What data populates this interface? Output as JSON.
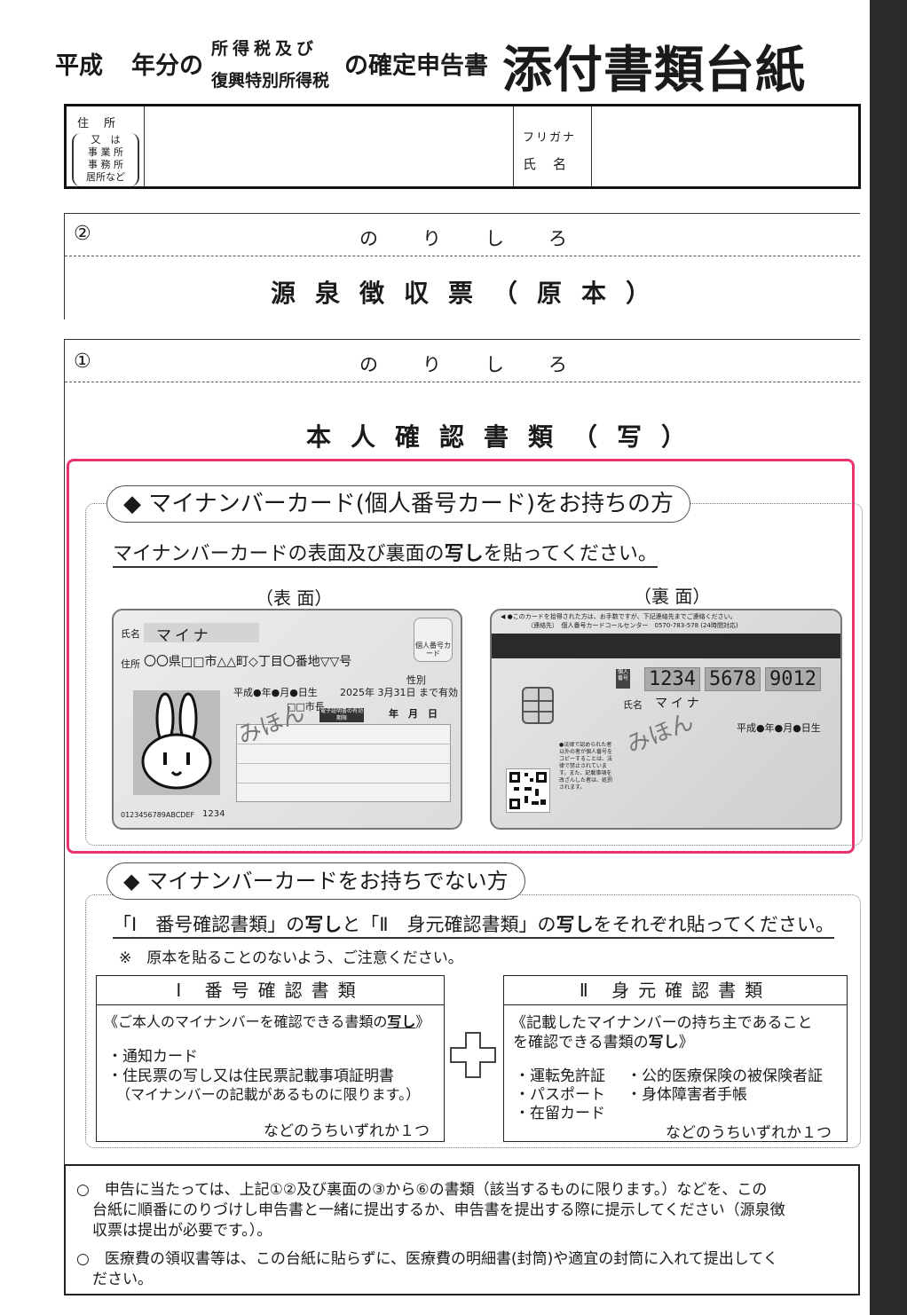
{
  "title": {
    "era": "平成",
    "year_suffix": "年分の",
    "tax_line1": "所得税及び",
    "tax_line2": "復興特別所得税",
    "doc_suffix": "の確定申告書",
    "main": "添付書類台紙"
  },
  "address_table": {
    "address_label": "住　所",
    "alt_labels": [
      "又　は",
      "事 業 所",
      "事 務 所",
      "居所など"
    ],
    "furigana_label": "フリガナ",
    "name_label": "氏　名"
  },
  "section2": {
    "number": "②",
    "paste_label": "のりしろ",
    "heading": "源泉徴収票（原本）"
  },
  "section1": {
    "number": "①",
    "paste_label": "のりしろ",
    "heading": "本人確認書類（写）"
  },
  "mynumber_card": {
    "pill": "◆ マイナンバーカード(個人番号カード)をお持ちの方",
    "instruction_pre": "マイナンバーカードの表面及び裏面の",
    "instruction_bold": "写し",
    "instruction_post": "を貼ってください。",
    "front_label": "（表 面）",
    "back_label": "（裏 面）",
    "front": {
      "name_label": "氏名",
      "name": "マイナ",
      "address_label": "住所",
      "address": "〇〇県□□市△△町◇丁目〇番地▽▽号",
      "gender_label": "性別",
      "birth": "平成●年●月●日生",
      "expiry": "2025年 3月31日 まで有効",
      "mayor": "□□市長",
      "sample": "みほん",
      "badge": "個人番号カード",
      "date_labels": "年　月　日",
      "small_label": "電子証明書の有効期限",
      "serial": "0123456789ABCDEF",
      "code": "1234"
    },
    "back": {
      "notice_line1": "◀ ●このカードを拾得された方は、お手数ですが、下記連絡先までご連絡ください。",
      "notice_line2": "（連絡先）　個人番号カードコールセンター　0570-783-578 (24時間対応)",
      "number_parts": [
        "1234",
        "5678",
        "9012"
      ],
      "number_tag": "個人番号",
      "name_label": "氏名",
      "name": "マイナ",
      "birth": "平成●年●月●日生",
      "sample": "みほん",
      "legal_note": "●法律で認められた者以外の者が個人番号をコピーすることは、法律で禁止されています。また、記載事項を改ざんした者は、処罰されます。"
    }
  },
  "no_card": {
    "pill": "◆ マイナンバーカードをお持ちでない方",
    "instruction_p1": "「Ⅰ　番号確認書類」の",
    "instruction_b1": "写し",
    "instruction_p2": "と「Ⅱ　身元確認書類」の",
    "instruction_b2": "写し",
    "instruction_p3": "をそれぞれ貼ってください。",
    "caution": "※　原本を貼ることのないよう、ご注意ください。",
    "plus": "＋",
    "box1": {
      "heading": "Ⅰ 番号確認書類",
      "intro_pre": "《ご本人のマイナンバーを確認できる書類の",
      "intro_bold": "写し",
      "intro_post": "》",
      "items": [
        "・通知カード",
        "・住民票の写し又は住民票記載事項証明書"
      ],
      "note": "（マイナンバーの記載があるものに限ります。）",
      "footer": "などのうちいずれか１つ"
    },
    "box2": {
      "heading": "Ⅱ 身元確認書類",
      "intro_line1": "《記載したマイナンバーの持ち主であること",
      "intro_pre": "を確認できる書類の",
      "intro_bold": "写し",
      "intro_post": "》",
      "col1": [
        "・運転免許証",
        "・パスポート",
        "・在留カード"
      ],
      "col2": [
        "・公的医療保険の被保険者証",
        "・身体障害者手帳"
      ],
      "footer": "などのうちいずれか１つ"
    }
  },
  "notes": {
    "note1_line1": "○　申告に当たっては、上記①②及び裏面の③から⑥の書類（該当するものに限ります。）などを、この",
    "note1_line2": "台紙に順番にのりづけし申告書と一緒に提出するか、申告書を提出する際に提示してください（源泉徴",
    "note1_line3": "収票は提出が必要です。）。",
    "note2_line1": "○　医療費の領収書等は、この台紙に貼らずに、医療費の明細書(封筒)や適宜の封筒に入れて提出してく",
    "note2_line2": "ださい。"
  }
}
